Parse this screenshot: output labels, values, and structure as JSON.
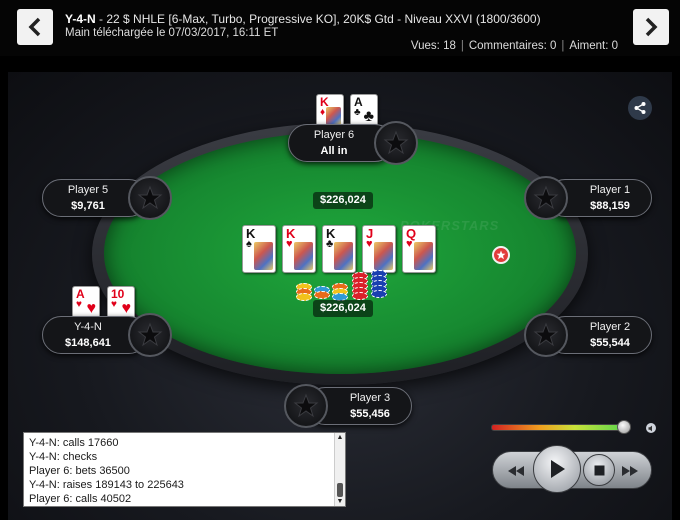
{
  "header": {
    "hero": "Y-4-N",
    "title_rest": " - 22 $ NHLE [6-Max, Turbo, Progressive KO], 20K$ Gtd - Niveau XXVI (1800/3600)",
    "downloaded": "Main téléchargée le 07/03/2017, 16:11 ET",
    "views": "Vues: 18",
    "comments": "Commentaires: 0",
    "likes": "Aiment: 0",
    "separator": "|"
  },
  "seats": {
    "p6": {
      "name": "Player 6",
      "chips": "All in",
      "cards": [
        {
          "rank": "K",
          "suit": "♦"
        },
        {
          "rank": "A",
          "suit": "♣"
        }
      ]
    },
    "p5": {
      "name": "Player 5",
      "chips": "$9,761"
    },
    "p1": {
      "name": "Player 1",
      "chips": "$88,159"
    },
    "hero": {
      "name": "Y-4-N",
      "chips": "$148,641",
      "cards": [
        {
          "rank": "A",
          "suit": "♥"
        },
        {
          "rank": "10",
          "suit": "♥"
        }
      ]
    },
    "p2": {
      "name": "Player 2",
      "chips": "$55,544"
    },
    "p3": {
      "name": "Player 3",
      "chips": "$55,456"
    }
  },
  "board": [
    {
      "rank": "K",
      "suit": "♠"
    },
    {
      "rank": "K",
      "suit": "♥"
    },
    {
      "rank": "K",
      "suit": "♣"
    },
    {
      "rank": "J",
      "suit": "♥"
    },
    {
      "rank": "Q",
      "suit": "♥"
    }
  ],
  "pot": {
    "top": "$226,024",
    "bottom": "$226,024"
  },
  "felt_watermark": "POKERSTARS",
  "log": [
    "Y-4-N: calls 17660",
    "Y-4-N: checks",
    "Player 6: bets 36500",
    "Y-4-N: raises 189143 to 225643",
    "Player 6: calls 40502"
  ],
  "icons": {
    "prev": "chevron-left-icon",
    "next": "chevron-right-icon",
    "share": "share-icon",
    "avatar": "pokerstars-star-icon",
    "speaker": "speaker-icon",
    "rewind": "rewind-icon",
    "play": "play-icon",
    "stop": "stop-icon",
    "forward": "fast-forward-icon"
  },
  "volume_level": 0.95,
  "colors": {
    "felt": "#178a31",
    "red_suit": "#e0001a",
    "dealer": "#e23b3b",
    "share_bg": "#2f3a4a"
  }
}
